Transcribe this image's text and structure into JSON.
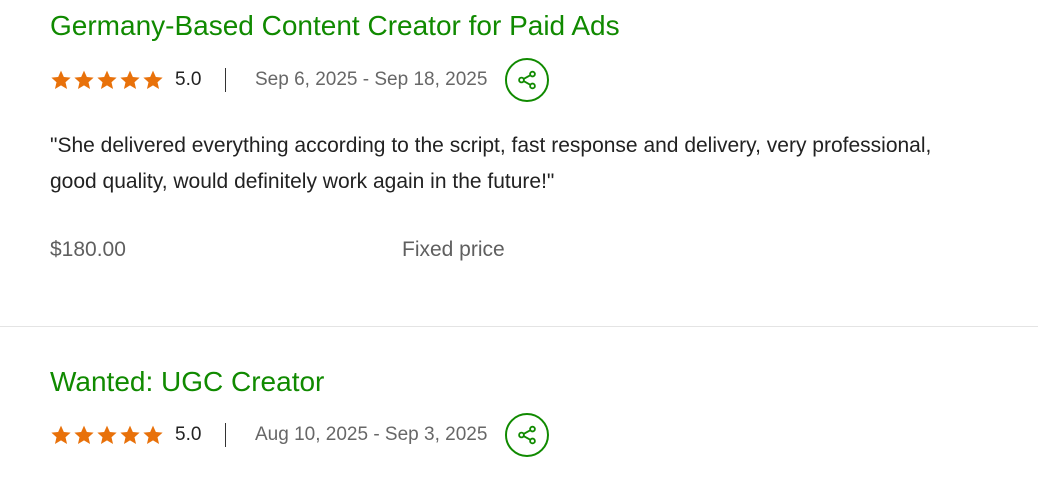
{
  "jobs": [
    {
      "title": "Germany-Based Content Creator for Paid Ads",
      "rating": "5.0",
      "dates": "Sep 6, 2025 - Sep 18, 2025",
      "feedback": "\"She delivered everything according to the script, fast response and delivery, very professional, good quality, would definitely work again in the future!\"",
      "price": "$180.00",
      "contract_type": "Fixed price",
      "stars": 5
    },
    {
      "title": "Wanted: UGC Creator",
      "rating": "5.0",
      "dates": "Aug 10, 2025 - Sep 3, 2025",
      "stars": 5
    }
  ],
  "colors": {
    "brand_green": "#108a00",
    "star_orange": "#e8710a"
  },
  "icons": {
    "star": "star-icon",
    "share": "share-icon"
  }
}
